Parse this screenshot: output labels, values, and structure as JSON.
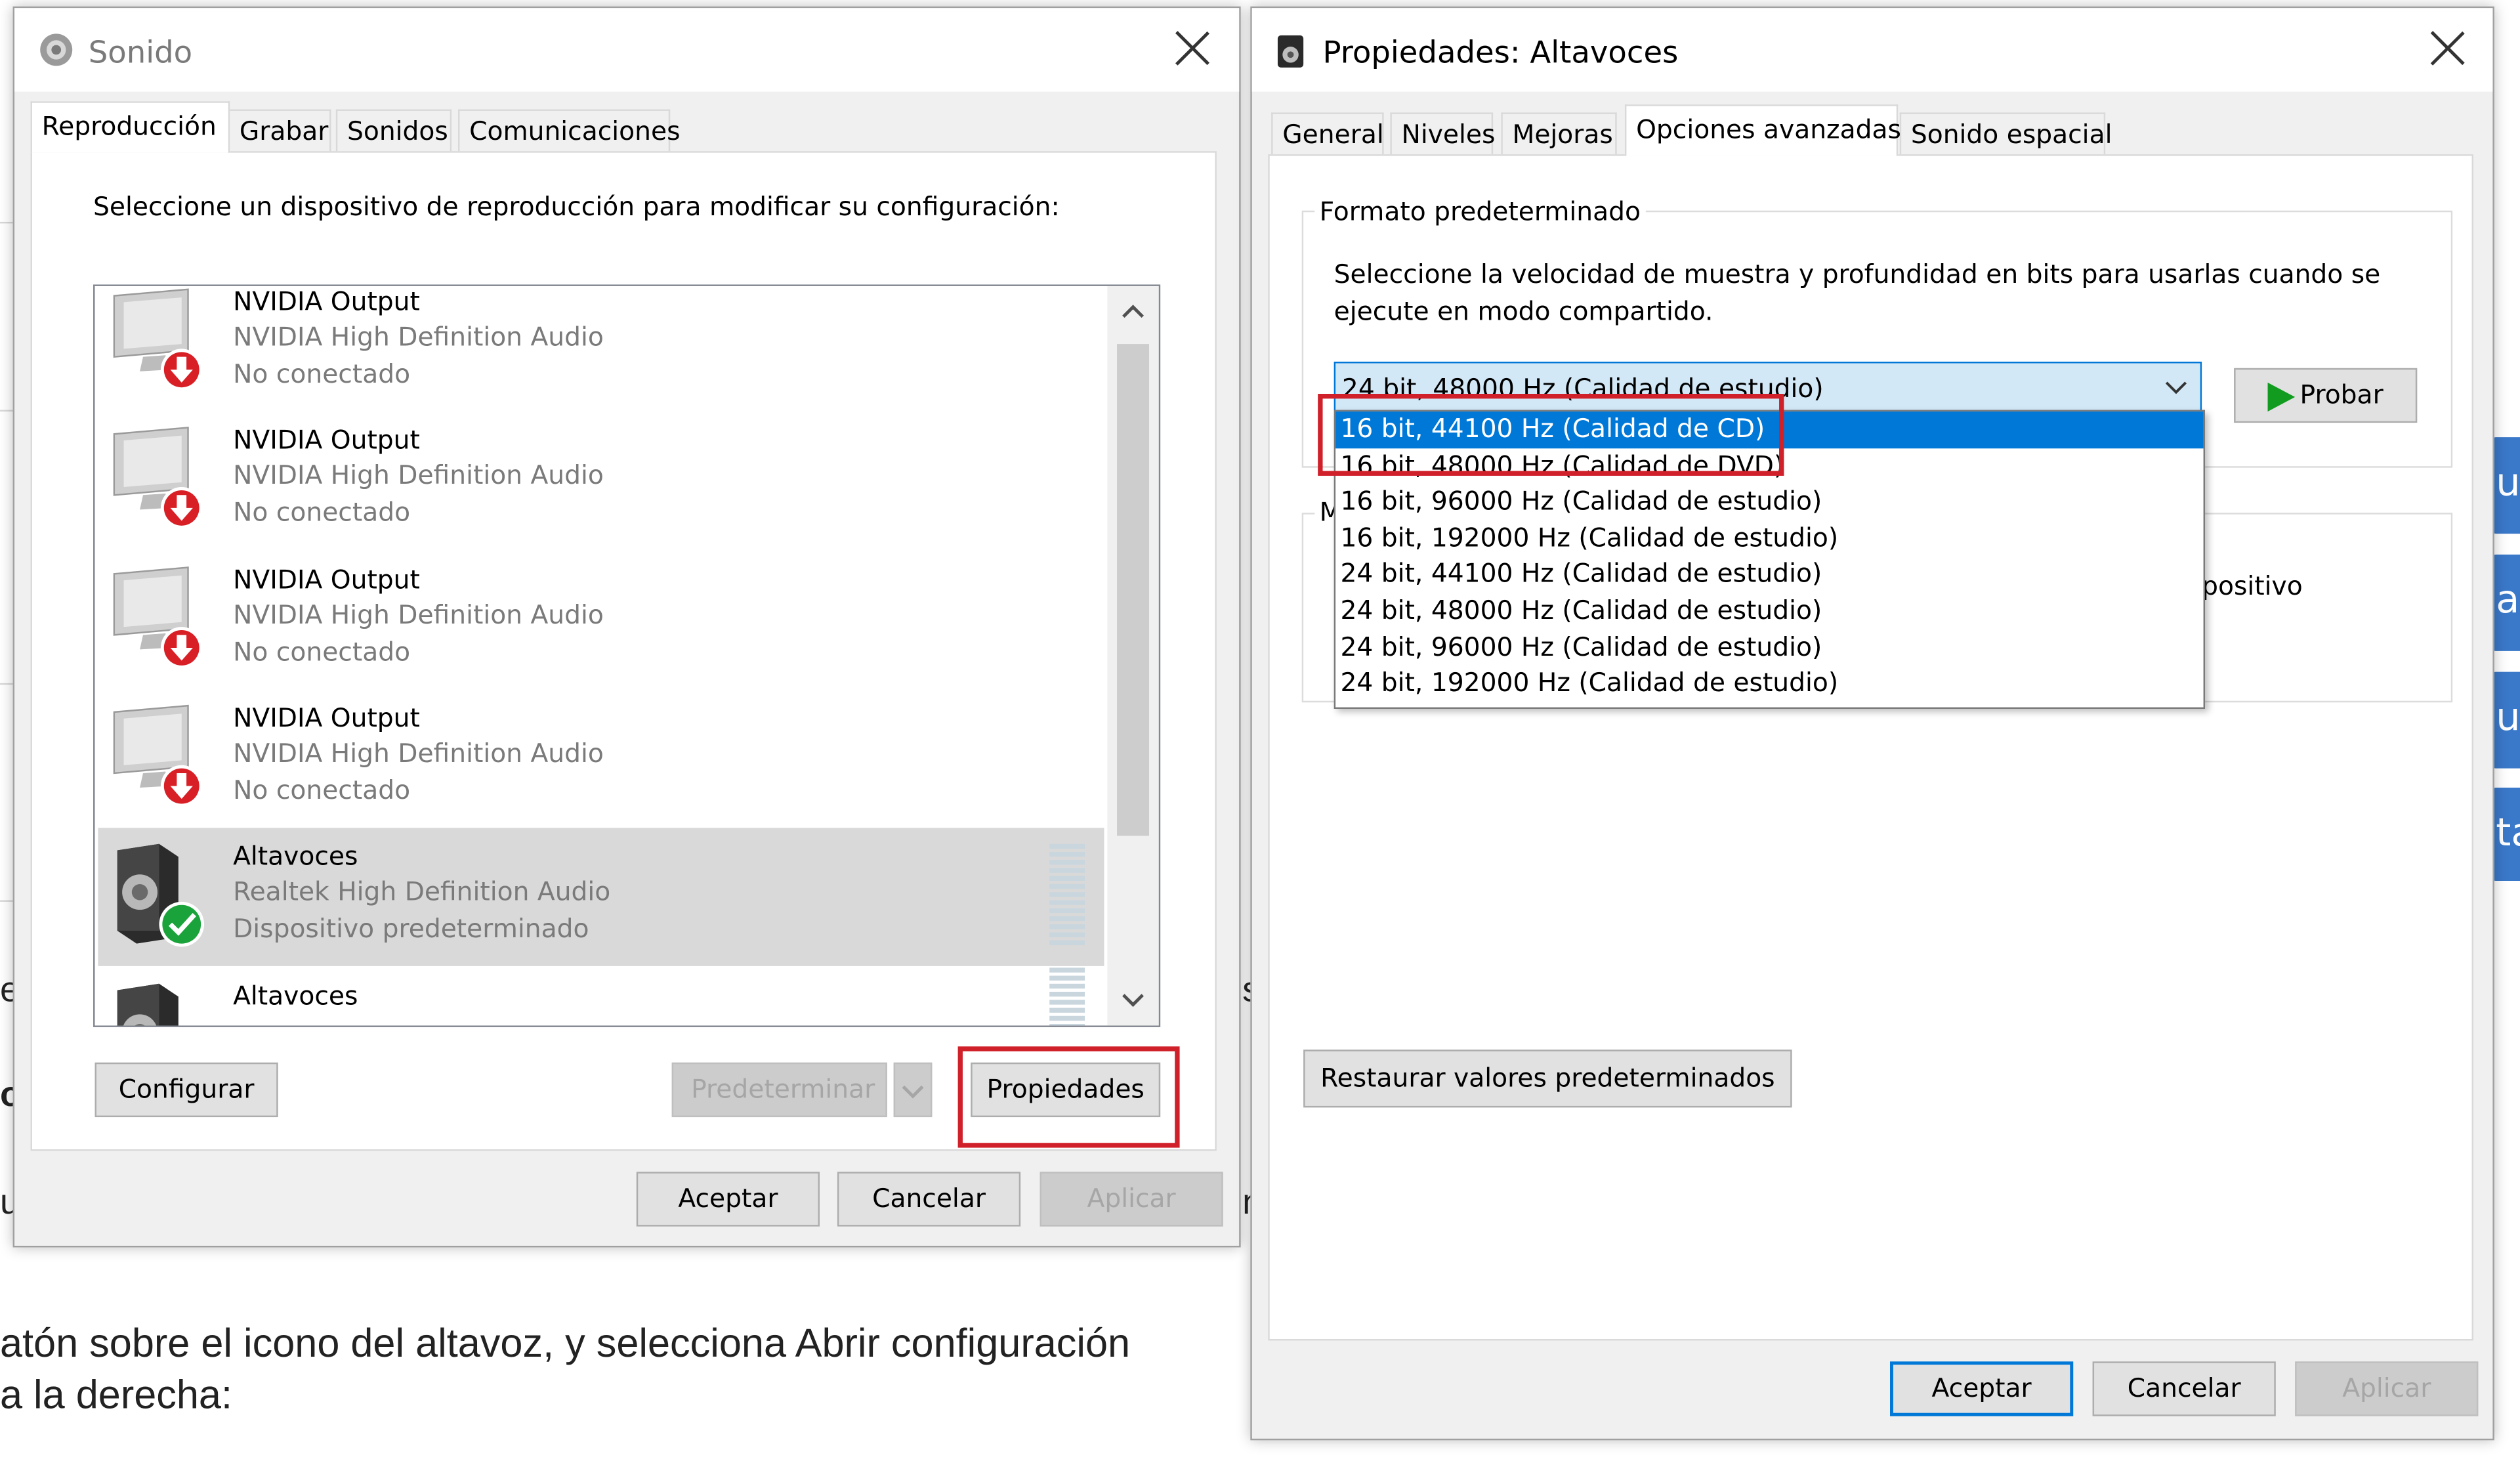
{
  "background": {
    "article_line1": "atón sobre el icono del altavoz, y selecciona Abrir configuración",
    "article_line2": "a la derecha:",
    "side_tabs": [
      "u",
      "a",
      "u",
      "ta"
    ]
  },
  "sonido": {
    "title": "Sonido",
    "tabs": [
      "Reproducción",
      "Grabar",
      "Sonidos",
      "Comunicaciones"
    ],
    "instruction": "Seleccione un dispositivo de reproducción para modificar su configuración:",
    "devices": [
      {
        "name": "NVIDIA Output",
        "driver": "NVIDIA High Definition Audio",
        "status": "No conectado",
        "icon": "monitor-disconnected-icon"
      },
      {
        "name": "NVIDIA Output",
        "driver": "NVIDIA High Definition Audio",
        "status": "No conectado",
        "icon": "monitor-disconnected-icon"
      },
      {
        "name": "NVIDIA Output",
        "driver": "NVIDIA High Definition Audio",
        "status": "No conectado",
        "icon": "monitor-disconnected-icon"
      },
      {
        "name": "NVIDIA Output",
        "driver": "NVIDIA High Definition Audio",
        "status": "No conectado",
        "icon": "monitor-disconnected-icon"
      },
      {
        "name": "Altavoces",
        "driver": "Realtek High Definition Audio",
        "status": "Dispositivo predeterminado",
        "icon": "speaker-default-icon"
      },
      {
        "name": "Altavoces",
        "driver": "",
        "status": "",
        "icon": "speaker-icon"
      }
    ],
    "configurar": "Configurar",
    "predeterminar": "Predeterminar",
    "propiedades": "Propiedades",
    "aceptar": "Aceptar",
    "cancelar": "Cancelar",
    "aplicar": "Aplicar"
  },
  "propiedades": {
    "title": "Propiedades: Altavoces",
    "tabs": [
      "General",
      "Niveles",
      "Mejoras",
      "Opciones avanzadas",
      "Sonido espacial"
    ],
    "group_title": "Formato predeterminado",
    "description_line1": "Seleccione la velocidad de muestra y profundidad en bits para usarlas cuando se",
    "description_line2": "ejecute en modo compartido.",
    "selected_format": "24 bit, 48000 Hz (Calidad de estudio)",
    "probar": "Probar",
    "formats": [
      "16 bit, 44100 Hz (Calidad de CD)",
      "16 bit, 48000 Hz (Calidad de DVD)",
      "16 bit, 96000 Hz (Calidad de estudio)",
      "16 bit, 192000 Hz (Calidad de estudio)",
      "24 bit, 44100 Hz (Calidad de estudio)",
      "24 bit, 48000 Hz (Calidad de estudio)",
      "24 bit, 96000 Hz (Calidad de estudio)",
      "24 bit, 192000 Hz (Calidad de estudio)"
    ],
    "highlighted_format": "16 bit, 44100 Hz (Calidad de CD)",
    "hidden_group_partial": "positivo",
    "hidden_group_letter": "M",
    "restaurar": "Restaurar valores predeterminados",
    "aceptar": "Aceptar",
    "cancelar": "Cancelar",
    "aplicar": "Aplicar"
  },
  "colors": {
    "accent": "#0078d7",
    "highlight_box": "#d0202a",
    "status_ok": "#1aa33a",
    "status_disconnected": "#d81f26"
  }
}
